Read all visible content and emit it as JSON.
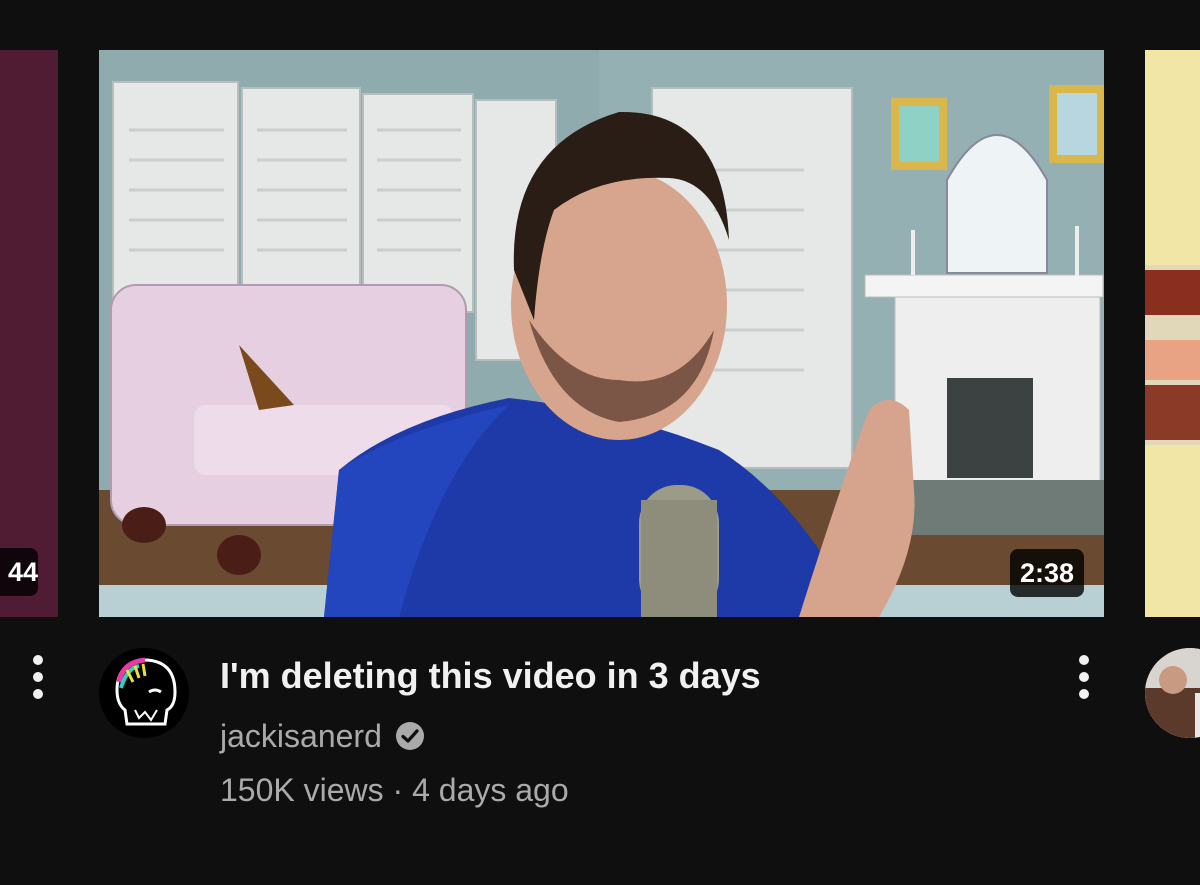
{
  "prev_video": {
    "duration_partial": "44"
  },
  "video": {
    "title": "I'm deleting this video in 3 days",
    "channel": "jackisanerd",
    "verified": true,
    "views": "150K views",
    "separator": "·",
    "age": "4 days ago",
    "duration": "2:38",
    "more_icon": "more-vert-icon",
    "verified_icon": "check-circle-icon"
  },
  "colors": {
    "background": "#0f0f0f",
    "title": "#f1f1f1",
    "secondary_text": "#aaaaaa",
    "prev_thumb": "#4f1c34",
    "next_thumb": "#f1e6a6"
  }
}
